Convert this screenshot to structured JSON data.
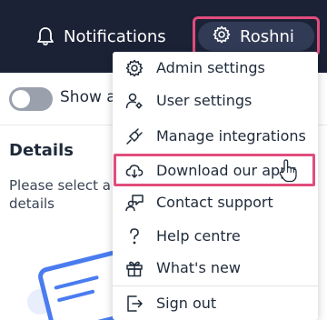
{
  "header": {
    "notifications_label": "Notifications",
    "user_name": "Roshni"
  },
  "toolbar": {
    "toggle_label": "Show ar"
  },
  "details": {
    "title": "Details",
    "description": "Please select a details"
  },
  "user_menu": {
    "items": [
      {
        "label": "Admin settings",
        "icon": "gear-icon"
      },
      {
        "label": "User settings",
        "icon": "user-gear-icon"
      },
      {
        "label": "Manage integrations",
        "icon": "plug-icon"
      },
      {
        "label": "Download our apps",
        "icon": "cloud-download-icon",
        "highlighted": true
      },
      {
        "label": "Contact support",
        "icon": "support-chat-icon"
      },
      {
        "label": "Help centre",
        "icon": "question-icon"
      },
      {
        "label": "What's new",
        "icon": "gift-icon"
      },
      {
        "label": "Sign out",
        "icon": "sign-out-icon"
      }
    ]
  },
  "colors": {
    "header_bg": "#1b2236",
    "user_pill_bg": "#313b56",
    "highlight_border": "#e14d7c",
    "illustration_blue": "#4a7cf0"
  }
}
